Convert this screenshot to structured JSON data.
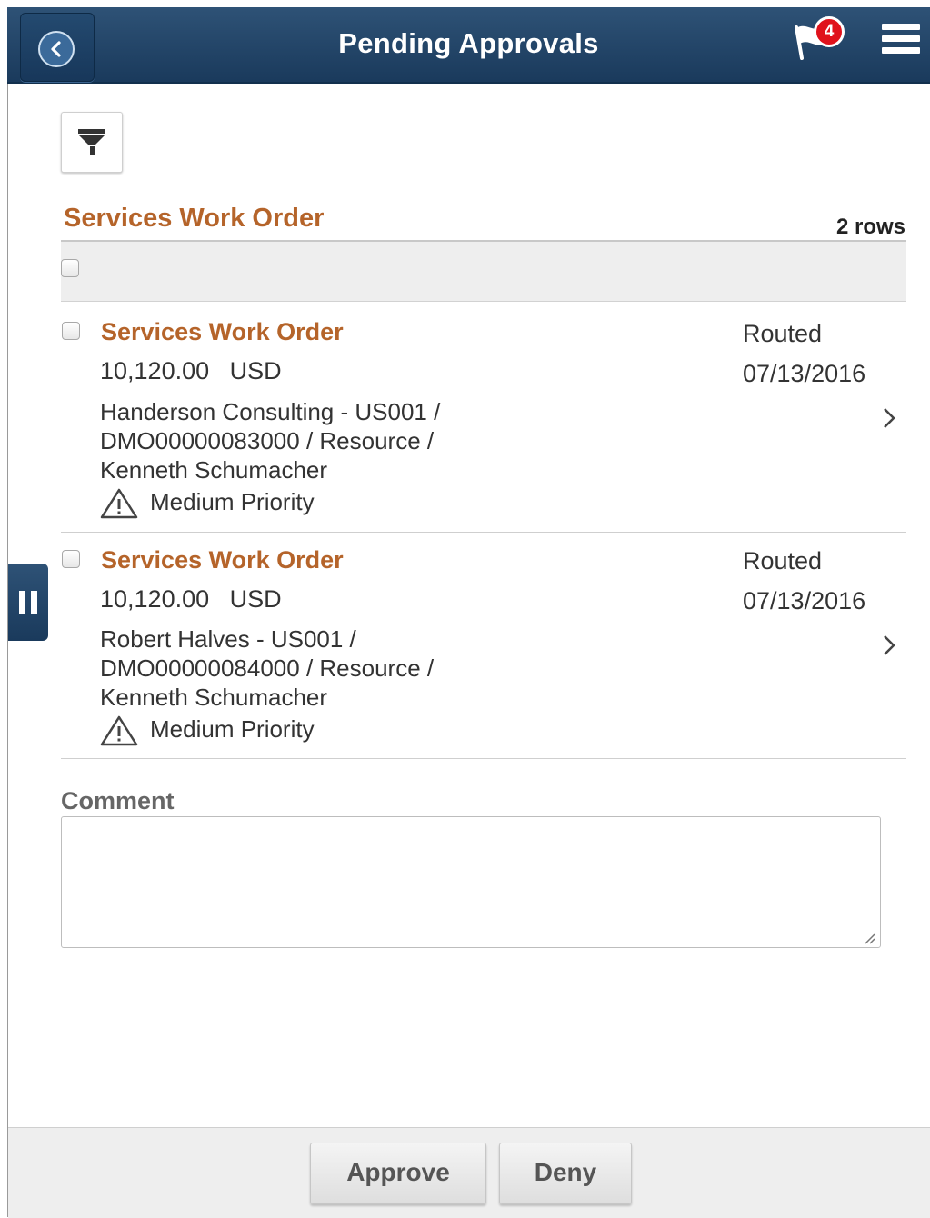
{
  "header": {
    "title": "Pending Approvals",
    "notification_count": "4"
  },
  "section": {
    "title": "Services Work Order",
    "rows_count": "2 rows"
  },
  "rows": [
    {
      "title": "Services Work Order",
      "amount": "10,120.00",
      "currency": "USD",
      "description_lines": [
        "Handerson Consulting - US001 /",
        "DMO00000083000 / Resource /",
        "Kenneth Schumacher"
      ],
      "priority": "Medium Priority",
      "status": "Routed",
      "date": "07/13/2016"
    },
    {
      "title": "Services Work Order",
      "amount": "10,120.00",
      "currency": "USD",
      "description_lines": [
        "Robert Halves - US001 /",
        "DMO00000084000 / Resource /",
        "Kenneth Schumacher"
      ],
      "priority": "Medium Priority",
      "status": "Routed",
      "date": "07/13/2016"
    }
  ],
  "comment": {
    "label": "Comment",
    "value": ""
  },
  "footer": {
    "approve_label": "Approve",
    "deny_label": "Deny"
  },
  "icons": {
    "back": "chevron-left-icon",
    "notifications": "flag-icon",
    "menu": "hamburger-menu-icon",
    "filter": "filter-funnel-icon",
    "priority": "warning-triangle-icon",
    "row_detail": "chevron-right-icon",
    "side_tab": "pause-icon"
  },
  "colors": {
    "header_bg": "#1f4266",
    "link": "#b5642a",
    "badge": "#e0121b"
  }
}
